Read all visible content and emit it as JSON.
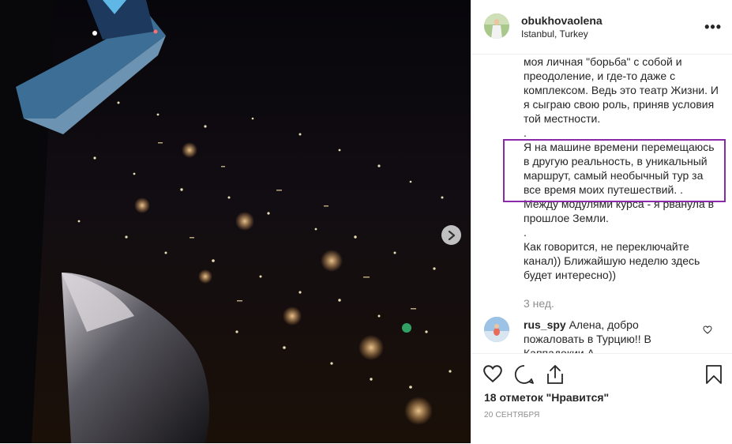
{
  "post": {
    "username": "obukhovaolena",
    "location": "Istanbul, Turkey",
    "more_label": "•••",
    "caption_lines": [
      "моя личная \"борьба\" с собой и преодоление, и где-то даже с комплексом. Ведь это театр Жизни. И я сыграю свою роль, приняв условия той местности.",
      ".",
      "Я на машине времени перемещаюсь в другую реальность, в уникальный маршрут, самый необычный тур за все время моих путешествий. .",
      "Между модулями курса - я рванула в прошлое Земли.",
      ".",
      "Как говорится, не переключайте канал)) Ближайшую неделю здесь будет интересно))"
    ],
    "time_ago": "3 нед.",
    "comment": {
      "username": "rus_spy",
      "text": "Алена, добро пожаловать в Турцию!! В Каппадокии А..."
    },
    "likes": "18 отметок \"Нравится\"",
    "date": "20 СЕНТЯБРЯ"
  },
  "colors": {
    "highlight_border": "#8a2aa8",
    "muted_text": "#8e8e8e",
    "divider": "#efefef"
  },
  "icons": [
    "chevron-right-icon",
    "more-icon",
    "heart-icon",
    "comment-icon",
    "share-icon",
    "bookmark-icon"
  ]
}
